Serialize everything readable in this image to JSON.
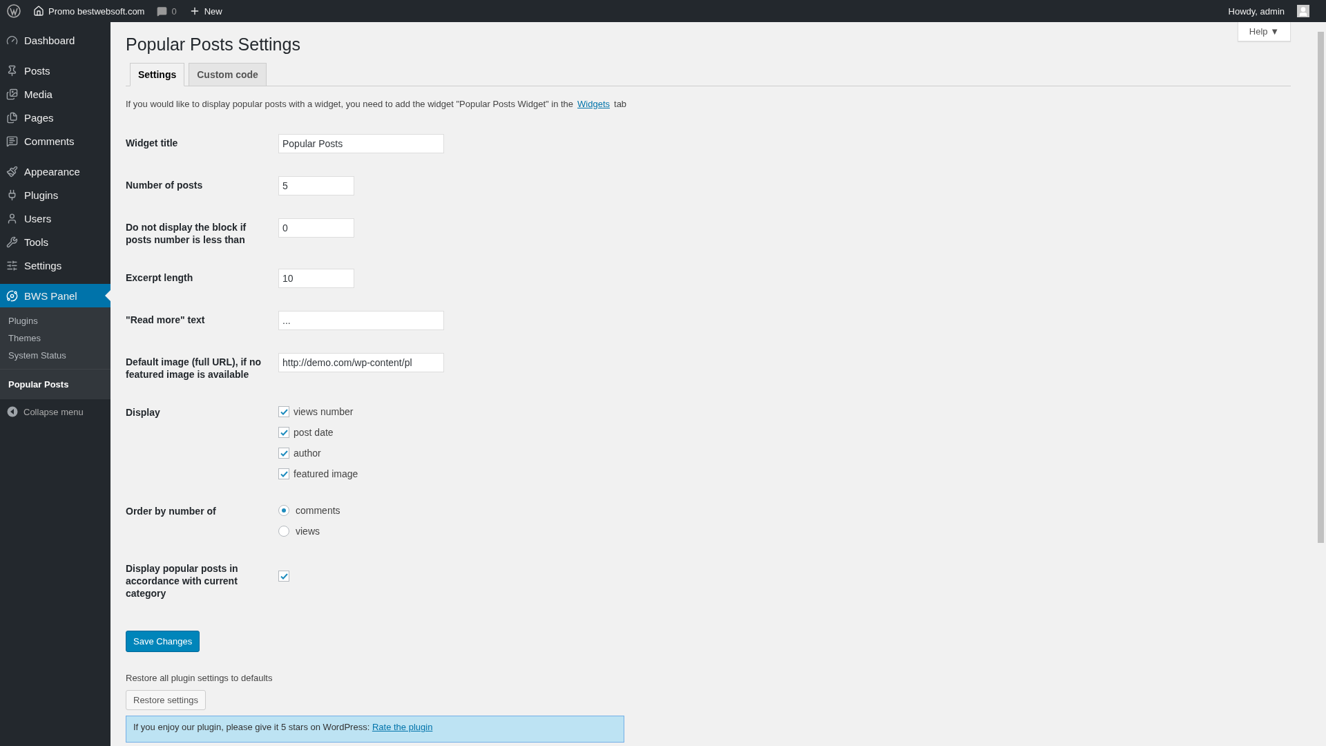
{
  "admin_bar": {
    "site": "Promo bestwebsoft.com",
    "comments": "0",
    "new": "New",
    "greeting": "Howdy, admin"
  },
  "sidebar": {
    "groups": [
      [
        {
          "label": "Dashboard",
          "selected": false
        }
      ],
      [
        {
          "label": "Posts",
          "selected": false
        },
        {
          "label": "Media",
          "selected": false
        },
        {
          "label": "Pages",
          "selected": false
        },
        {
          "label": "Comments",
          "selected": false
        }
      ],
      [
        {
          "label": "Appearance",
          "selected": false
        },
        {
          "label": "Plugins",
          "selected": false
        },
        {
          "label": "Users",
          "selected": false
        },
        {
          "label": "Tools",
          "selected": false
        },
        {
          "label": "Settings",
          "selected": false
        }
      ],
      [
        {
          "label": "BWS Panel",
          "selected": true,
          "children": [
            {
              "label": "Plugins",
              "selected": false
            },
            {
              "label": "Themes",
              "selected": false
            },
            {
              "label": "System Status",
              "selected": false
            }
          ]
        }
      ]
    ],
    "extra_item": {
      "label": "Popular Posts",
      "selected": true
    },
    "collapse": "Collapse menu"
  },
  "help": "Help ▼",
  "title": "Popular Posts Settings",
  "tabs": [
    {
      "label": "Settings",
      "selected": true
    },
    {
      "label": "Custom code",
      "selected": false
    }
  ],
  "intro": {
    "before": "If you would like to display popular posts with a widget, you need to add the widget \"Popular Posts Widget\" in the",
    "link": "Widgets",
    "after": "tab"
  },
  "rows": [
    {
      "kind": "text",
      "label": "Widget title",
      "value": "Popular Posts"
    },
    {
      "kind": "number",
      "label": "Number of posts",
      "value": "5"
    },
    {
      "kind": "number",
      "label": "Do not display the block if posts number is less than",
      "value": "0"
    },
    {
      "kind": "number",
      "label": "Excerpt length",
      "value": "10"
    },
    {
      "kind": "text",
      "label": "\"Read more\" text",
      "value": "..."
    },
    {
      "kind": "text",
      "label": "Default image (full URL), if no featured image is available",
      "value": "http://demo.com/wp-content/pl"
    },
    {
      "kind": "checks",
      "label": "Display",
      "options": [
        {
          "label": "views number",
          "checked": true
        },
        {
          "label": "post date",
          "checked": true
        },
        {
          "label": "author",
          "checked": true
        },
        {
          "label": "featured image",
          "checked": true
        }
      ]
    },
    {
      "kind": "radios",
      "label": "Order by number of",
      "options": [
        {
          "label": "comments",
          "selected": true
        },
        {
          "label": "views",
          "selected": false
        }
      ]
    },
    {
      "kind": "check",
      "label": "Display popular posts in accordance with current category",
      "checked": true
    }
  ],
  "save": "Save Changes",
  "restore_text": "Restore all plugin settings to defaults",
  "restore_button": "Restore settings",
  "notice": {
    "text": "If you enjoy our plugin, please give it 5 stars on WordPress:",
    "link": "Rate the plugin"
  }
}
